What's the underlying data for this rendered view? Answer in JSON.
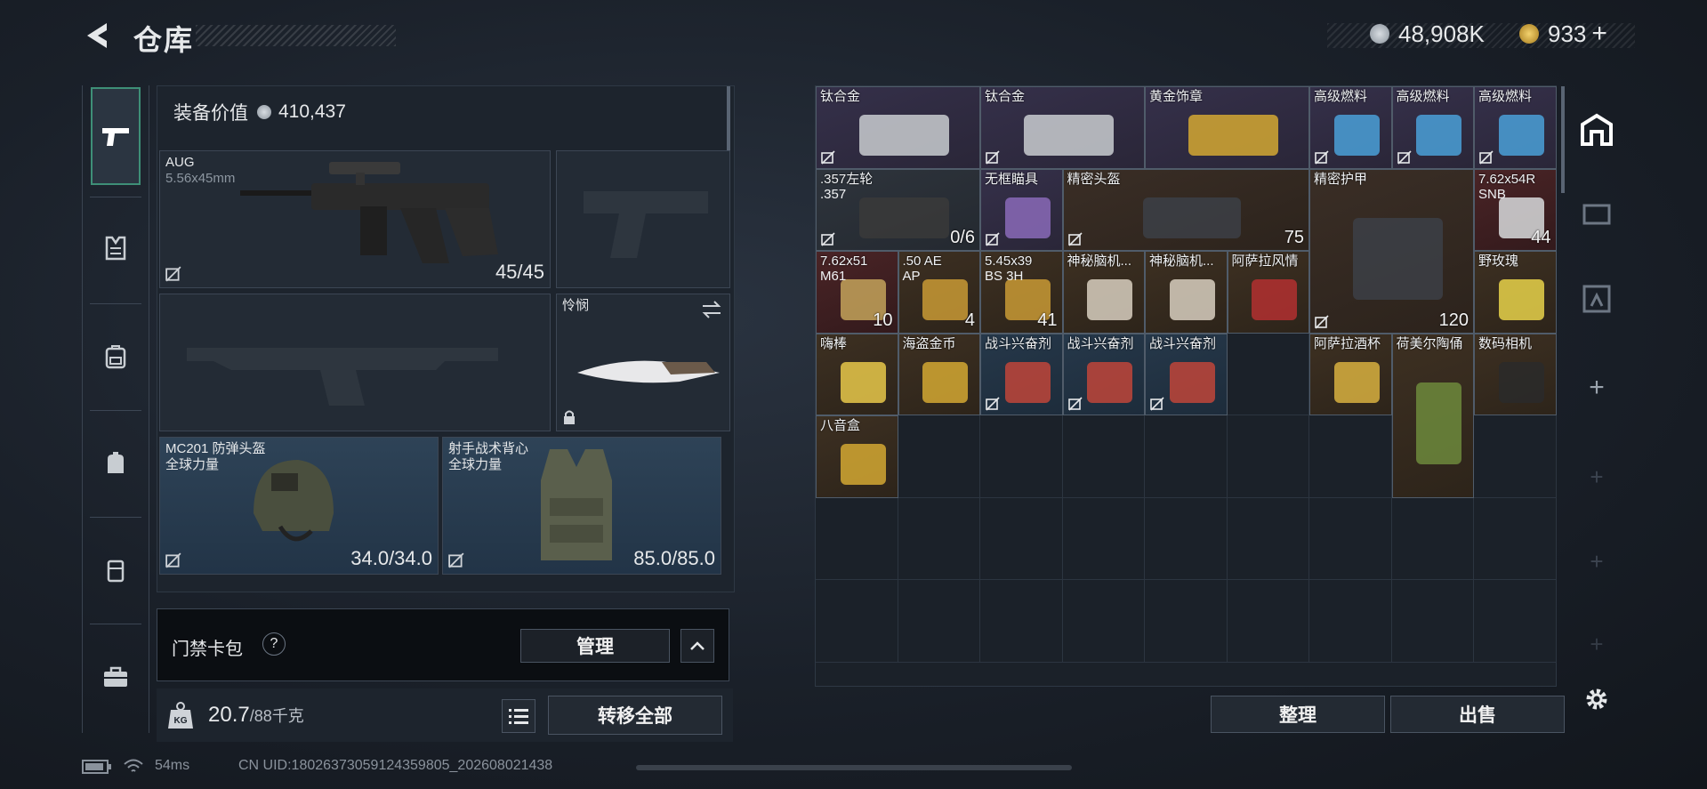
{
  "header": {
    "title": "仓库",
    "silver": "48,908K",
    "gold": "933"
  },
  "loadout": {
    "equip_value_label": "装备价值",
    "equip_value": "410,437",
    "primary": {
      "name": "AUG",
      "caliber": "5.56x45mm",
      "ammo": "45/45"
    },
    "melee": {
      "name": "怜悯"
    },
    "helmet": {
      "name": "MC201 防弹头盔",
      "brand": "全球力量",
      "durability": "34.0/34.0"
    },
    "armor": {
      "name": "射手战术背心",
      "brand": "全球力量",
      "durability": "85.0/85.0"
    },
    "keycard": {
      "label": "门禁卡包",
      "help": "?",
      "manage": "管理"
    },
    "weight": {
      "current": "20.7",
      "capacity": "/88千克",
      "badge": "KG"
    },
    "transfer_all": "转移全部"
  },
  "stash": {
    "items": [
      {
        "name": "钛合金",
        "sub": "",
        "count": "",
        "nosell": true
      },
      {
        "name": "钛合金",
        "sub": "",
        "count": "",
        "nosell": true
      },
      {
        "name": "黄金饰章",
        "sub": "",
        "count": "",
        "nosell": false
      },
      {
        "name": "高级燃料",
        "sub": "",
        "count": "",
        "nosell": true
      },
      {
        "name": "高级燃料",
        "sub": "",
        "count": "",
        "nosell": true
      },
      {
        "name": "高级燃料",
        "sub": "",
        "count": "",
        "nosell": true
      },
      {
        "name": ".357左轮",
        "sub": ".357",
        "count": "0/6",
        "nosell": true
      },
      {
        "name": "无框瞄具",
        "sub": "",
        "count": "",
        "nosell": true
      },
      {
        "name": "精密头盔",
        "sub": "",
        "count": "75",
        "nosell": true
      },
      {
        "name": "精密护甲",
        "sub": "",
        "count": "120",
        "nosell": true
      },
      {
        "name": "7.62x54R",
        "sub": "SNB",
        "count": "44",
        "nosell": false
      },
      {
        "name": "7.62x51",
        "sub": "M61",
        "count": "10",
        "nosell": false
      },
      {
        "name": ".50 AE",
        "sub": "AP",
        "count": "4",
        "nosell": false
      },
      {
        "name": "5.45x39",
        "sub": "BS 3H",
        "count": "41",
        "nosell": false
      },
      {
        "name": "神秘脑机...",
        "sub": "",
        "count": "",
        "nosell": false
      },
      {
        "name": "神秘脑机...",
        "sub": "",
        "count": "",
        "nosell": false
      },
      {
        "name": "阿萨拉风情",
        "sub": "",
        "count": "",
        "nosell": false
      },
      {
        "name": "野玫瑰",
        "sub": "",
        "count": "",
        "nosell": false
      },
      {
        "name": "嗨棒",
        "sub": "",
        "count": "",
        "nosell": false
      },
      {
        "name": "海盗金币",
        "sub": "",
        "count": "",
        "nosell": false
      },
      {
        "name": "战斗兴奋剂",
        "sub": "",
        "count": "",
        "nosell": true
      },
      {
        "name": "战斗兴奋剂",
        "sub": "",
        "count": "",
        "nosell": true
      },
      {
        "name": "战斗兴奋剂",
        "sub": "",
        "count": "",
        "nosell": true
      },
      {
        "name": "阿萨拉酒杯",
        "sub": "",
        "count": "",
        "nosell": false
      },
      {
        "name": "荷美尔陶俑",
        "sub": "",
        "count": "",
        "nosell": false
      },
      {
        "name": "数码相机",
        "sub": "",
        "count": "",
        "nosell": false
      },
      {
        "name": "八音盒",
        "sub": "",
        "count": "",
        "nosell": false
      }
    ],
    "sort": "整理",
    "sell": "出售"
  },
  "status": {
    "ping": "54ms",
    "uid": "CN UID:18026373059124359805_202608021438"
  },
  "colors": {
    "accent": "#3e8f77",
    "panel": "#1d242d",
    "purple": "#35304a",
    "gold": "#3d3022",
    "red": "#4a2426",
    "blue": "#26384a"
  }
}
